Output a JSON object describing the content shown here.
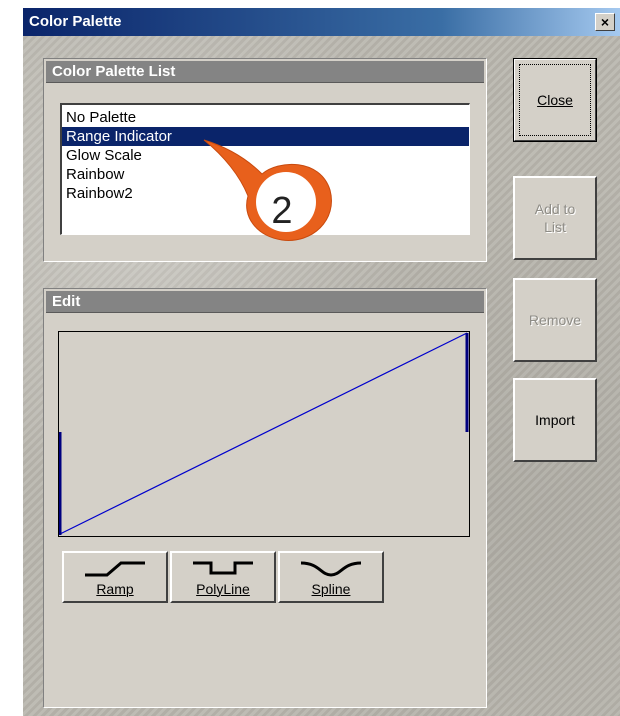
{
  "window": {
    "title": "Color Palette",
    "close_glyph": "×"
  },
  "palette_list": {
    "header": "Color Palette List",
    "items": [
      "No Palette",
      "Range Indicator",
      "Glow Scale",
      "Rainbow",
      "Rainbow2"
    ],
    "selected_index": 1
  },
  "edit": {
    "header": "Edit",
    "curve_color": "#0000cc",
    "buttons": [
      {
        "label": "Ramp",
        "icon": "ramp-curve-icon"
      },
      {
        "label": "PolyLine",
        "icon": "polyline-curve-icon"
      },
      {
        "label": "Spline",
        "icon": "spline-curve-icon"
      }
    ]
  },
  "side_buttons": {
    "close": "Close",
    "add_to_list": "Add to List",
    "remove": "Remove",
    "import": "Import"
  },
  "callout": {
    "number": "2",
    "color": "#e8601c"
  }
}
